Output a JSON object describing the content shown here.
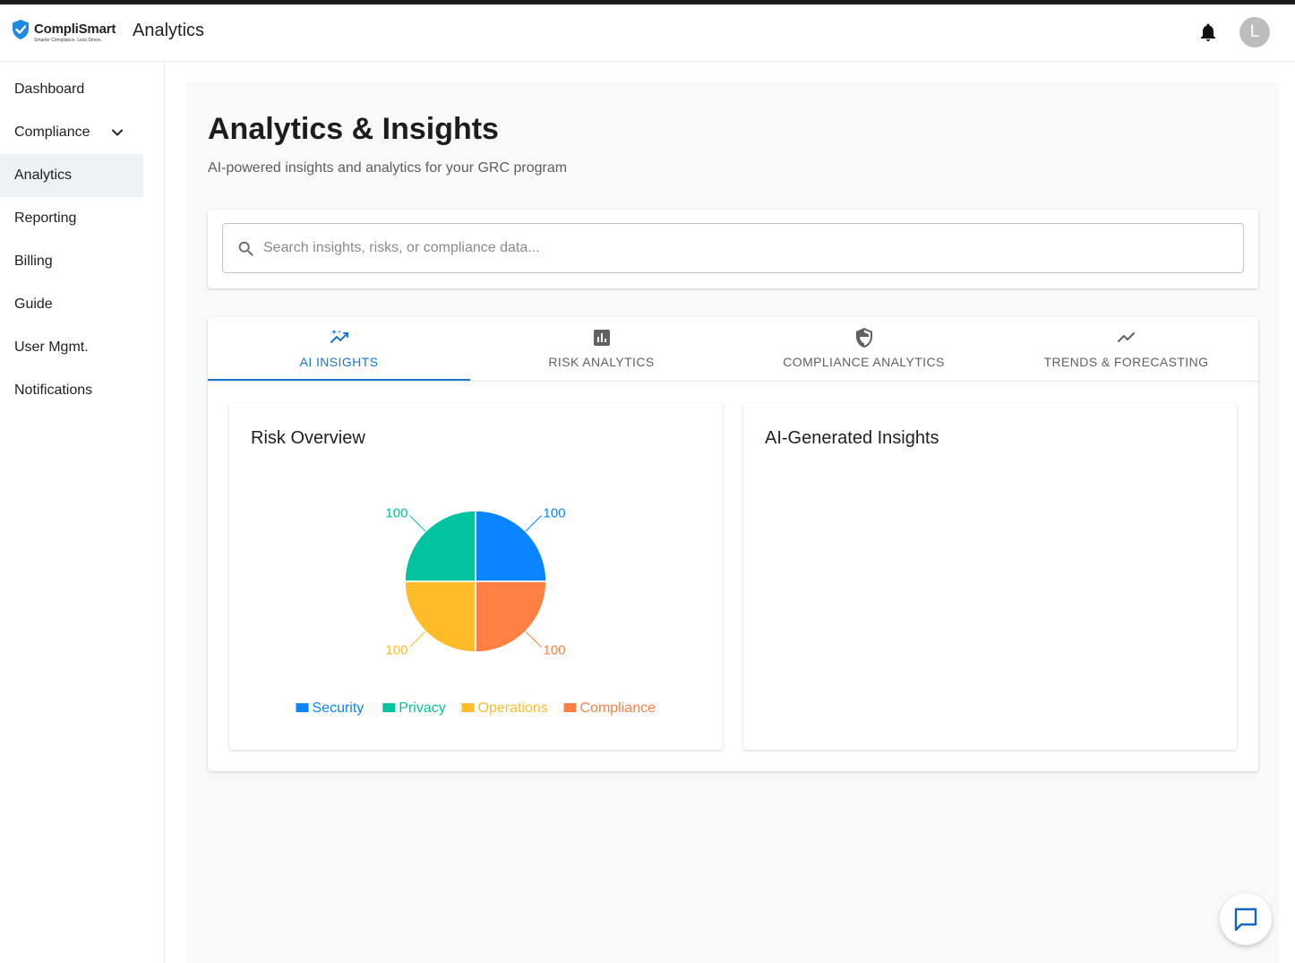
{
  "header": {
    "logo_name": "CompliSmart",
    "logo_tagline": "Smarter Compliance. Less Stress.",
    "app_title": "Analytics",
    "avatar_initial": "L",
    "icons": [
      "shield-logo-icon",
      "bell-icon"
    ]
  },
  "sidebar": {
    "items": [
      {
        "label": "Dashboard"
      },
      {
        "label": "Compliance",
        "expandable": true
      },
      {
        "label": "Analytics",
        "active": true
      },
      {
        "label": "Reporting"
      },
      {
        "label": "Billing"
      },
      {
        "label": "Guide"
      },
      {
        "label": "User Mgmt."
      },
      {
        "label": "Notifications"
      }
    ]
  },
  "page": {
    "title": "Analytics & Insights",
    "subtitle": "AI-powered insights and analytics for your GRC program"
  },
  "search": {
    "placeholder": "Search insights, risks, or compliance data...",
    "value": ""
  },
  "tabs": [
    {
      "label": "AI INSIGHTS",
      "icon": "ai-sparkle-chart-icon",
      "active": true
    },
    {
      "label": "RISK ANALYTICS",
      "icon": "bar-chart-box-icon"
    },
    {
      "label": "COMPLIANCE ANALYTICS",
      "icon": "shield-icon"
    },
    {
      "label": "TRENDS & FORECASTING",
      "icon": "trending-line-icon"
    }
  ],
  "panels": {
    "risk_overview_title": "Risk Overview",
    "ai_insights_title": "AI-Generated Insights"
  },
  "colors": {
    "accent": "#1976d2",
    "security": "#0a84ff",
    "privacy": "#00c49f",
    "operations": "#ffbb28",
    "compliance": "#ff8042"
  },
  "chart_data": {
    "type": "pie",
    "categories": [
      "Security",
      "Privacy",
      "Operations",
      "Compliance"
    ],
    "values": [
      100,
      100,
      100,
      100
    ],
    "data_labels": [
      "100",
      "100",
      "100",
      "100"
    ],
    "legend": "bottom"
  }
}
